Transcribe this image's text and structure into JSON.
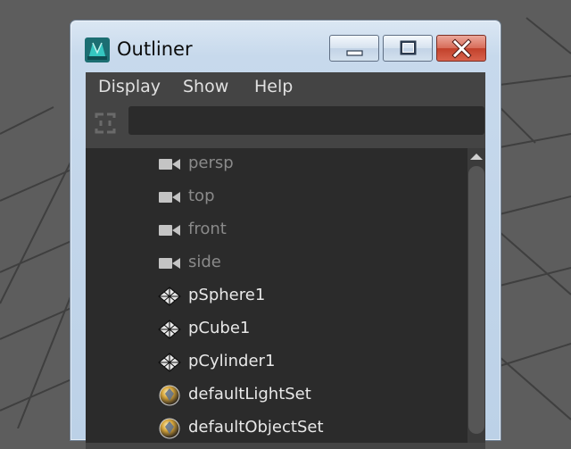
{
  "window": {
    "title": "Outliner"
  },
  "menubar": {
    "items": [
      "Display",
      "Show",
      "Help"
    ]
  },
  "filter": {
    "value": "",
    "placeholder": ""
  },
  "outliner": {
    "items": [
      {
        "label": "persp",
        "icon": "camera-icon",
        "dimmed": true
      },
      {
        "label": "top",
        "icon": "camera-icon",
        "dimmed": true
      },
      {
        "label": "front",
        "icon": "camera-icon",
        "dimmed": true
      },
      {
        "label": "side",
        "icon": "camera-icon",
        "dimmed": true
      },
      {
        "label": "pSphere1",
        "icon": "mesh-icon",
        "dimmed": false
      },
      {
        "label": "pCube1",
        "icon": "mesh-icon",
        "dimmed": false
      },
      {
        "label": "pCylinder1",
        "icon": "mesh-icon",
        "dimmed": false
      },
      {
        "label": "defaultLightSet",
        "icon": "set-sphere-icon",
        "dimmed": false
      },
      {
        "label": "defaultObjectSet",
        "icon": "set-sphere-icon",
        "dimmed": false
      }
    ]
  },
  "colors": {
    "panel_bg": "#444444",
    "tree_bg": "#2b2b2b",
    "close_button": "#c8493a",
    "title_bar": "#c7d9ec"
  }
}
